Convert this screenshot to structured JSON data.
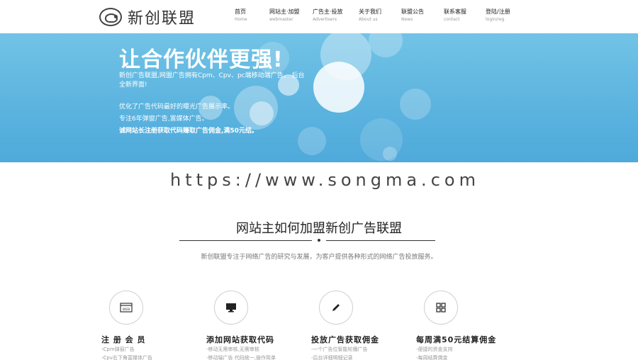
{
  "header": {
    "logo_text": "新创联盟",
    "nav": [
      {
        "cn": "首页",
        "en": "Home"
      },
      {
        "cn": "网站主·加盟",
        "en": "webmaster"
      },
      {
        "cn": "广告主·投放",
        "en": "Advertisers"
      },
      {
        "cn": "关于我们",
        "en": "About us"
      },
      {
        "cn": "联盟公告",
        "en": "News"
      },
      {
        "cn": "联系客服",
        "en": "contact"
      },
      {
        "cn": "登陆/注册",
        "en": "login/reg"
      }
    ]
  },
  "banner": {
    "title": "让合作伙伴更强!",
    "desc": "新创广告联盟,网盟广告拥有Cpm、Cpv、pc端移动端广告。 后台全新界面!",
    "line1": "优化了广告代码最好的曝光广告展示率。",
    "line2": "专注6年弹窗广告,富媒体广告。",
    "line3": "诚网站长注册获取代码赚取广告佣金,满50元结。"
  },
  "watermark": "https://www.songma.com",
  "section": {
    "title": "网站主如何加盟新创广告联盟",
    "subtitle": "新创联盟专注于网络广告的研究与发展，为客户提供各种形式的网络广告投放服务。"
  },
  "features": [
    {
      "title": "注 册 会 员",
      "line1": "-Cpm弹窗广告",
      "line2": "-Cpv右下角富媒体广告",
      "icon": "web-icon"
    },
    {
      "title": "添加网站获取代码",
      "line1": "-移动无需审核,无需审核",
      "line2": "-移动端广告 代码统一,操作简单",
      "icon": "monitor-icon"
    },
    {
      "title": "投放广告获取佣金",
      "line1": "-一个广告位智能轮播广告",
      "line2": "-后台详细明细记录",
      "icon": "pencil-icon"
    },
    {
      "title": "每周满50元结算佣金",
      "line1": "-便捷的资金支持",
      "line2": "-每周结算佣金",
      "icon": "grid-icon"
    }
  ],
  "colors": {
    "banner": "#5cb4df",
    "text": "#333333"
  }
}
